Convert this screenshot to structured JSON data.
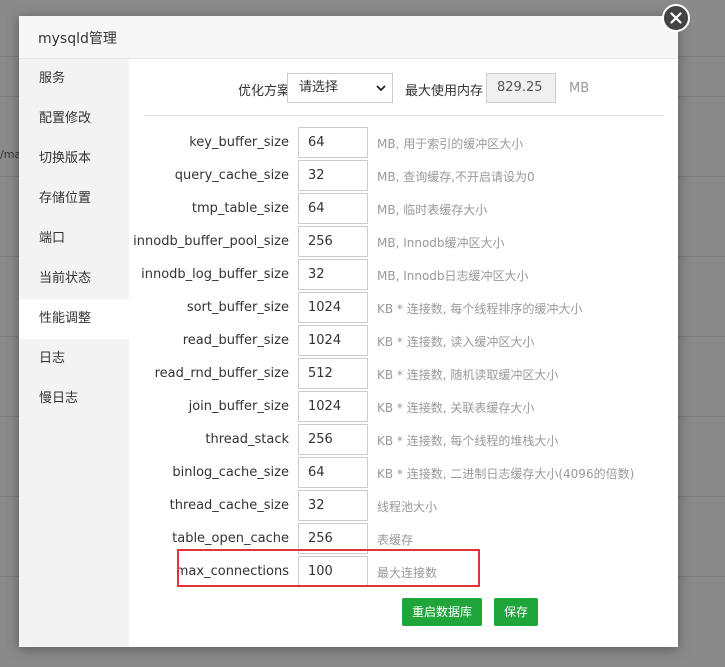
{
  "background": {
    "fragment": "/ma"
  },
  "modal": {
    "title": "mysqld管理"
  },
  "sidebar": {
    "items": [
      {
        "label": "服务"
      },
      {
        "label": "配置修改"
      },
      {
        "label": "切换版本"
      },
      {
        "label": "存储位置"
      },
      {
        "label": "端口"
      },
      {
        "label": "当前状态"
      },
      {
        "label": "性能调整",
        "active": true
      },
      {
        "label": "日志"
      },
      {
        "label": "慢日志"
      }
    ]
  },
  "optimization": {
    "label": "优化方案",
    "select_value": "请选择",
    "max_mem_label": "最大使用内存",
    "max_mem_value": "829.25",
    "max_mem_unit": "MB"
  },
  "params": [
    {
      "name": "key_buffer_size",
      "value": "64",
      "desc": "MB, 用于索引的缓冲区大小"
    },
    {
      "name": "query_cache_size",
      "value": "32",
      "desc": "MB, 查询缓存,不开启请设为0"
    },
    {
      "name": "tmp_table_size",
      "value": "64",
      "desc": "MB, 临时表缓存大小"
    },
    {
      "name": "innodb_buffer_pool_size",
      "value": "256",
      "desc": "MB, Innodb缓冲区大小"
    },
    {
      "name": "innodb_log_buffer_size",
      "value": "32",
      "desc": "MB, Innodb日志缓冲区大小"
    },
    {
      "name": "sort_buffer_size",
      "value": "1024",
      "desc": "KB * 连接数, 每个线程排序的缓冲大小"
    },
    {
      "name": "read_buffer_size",
      "value": "1024",
      "desc": "KB * 连接数, 读入缓冲区大小"
    },
    {
      "name": "read_rnd_buffer_size",
      "value": "512",
      "desc": "KB * 连接数, 随机读取缓冲区大小"
    },
    {
      "name": "join_buffer_size",
      "value": "1024",
      "desc": "KB * 连接数, 关联表缓存大小"
    },
    {
      "name": "thread_stack",
      "value": "256",
      "desc": "KB * 连接数, 每个线程的堆栈大小"
    },
    {
      "name": "binlog_cache_size",
      "value": "64",
      "desc": "KB * 连接数, 二进制日志缓存大小(4096的倍数)"
    },
    {
      "name": "thread_cache_size",
      "value": "32",
      "desc": "线程池大小"
    },
    {
      "name": "table_open_cache",
      "value": "256",
      "desc": "表缓存"
    },
    {
      "name": "max_connections",
      "value": "100",
      "desc": "最大连接数"
    }
  ],
  "buttons": {
    "restart": "重启数据库",
    "save": "保存"
  },
  "colors": {
    "primary": "#20a53a",
    "highlight": "#e0333a"
  }
}
